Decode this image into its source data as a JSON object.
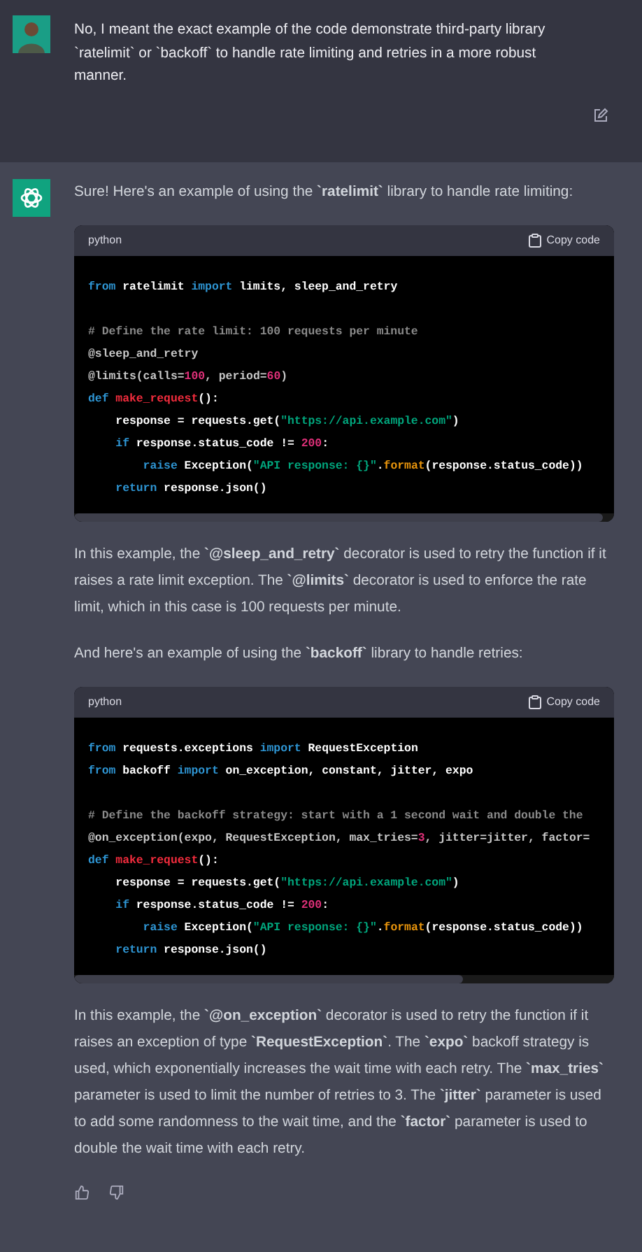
{
  "user_message": {
    "text": "No, I meant the exact example of the code demonstrate third-party library `ratelimit` or `backoff` to handle rate limiting and retries in a more robust manner."
  },
  "assistant_message": {
    "blocks": [
      {
        "kind": "paragraph",
        "text": "Sure! Here's an example of using the **`ratelimit`** library to handle rate limiting:"
      },
      {
        "kind": "code",
        "language": "python",
        "copy_label": "Copy code",
        "lines": [
          {
            "kind": "code",
            "tokens": [
              {
                "text": "from",
                "kind": "kw"
              },
              {
                "text": " ratelimit ",
                "kind": "plain"
              },
              {
                "text": "import",
                "kind": "kw"
              },
              {
                "text": " limits, sleep_and_retry",
                "kind": "plain"
              }
            ]
          },
          {
            "kind": "blank"
          },
          {
            "kind": "code",
            "tokens": [
              {
                "text": "# Define the rate limit: 100 requests per minute",
                "kind": "comment"
              }
            ]
          },
          {
            "kind": "code",
            "tokens": [
              {
                "text": "@sleep_and_retry",
                "kind": "deco"
              }
            ]
          },
          {
            "kind": "code",
            "tokens": [
              {
                "text": "@limits(calls=",
                "kind": "deco"
              },
              {
                "text": "100",
                "kind": "num"
              },
              {
                "text": ", period=",
                "kind": "deco"
              },
              {
                "text": "60",
                "kind": "num"
              },
              {
                "text": ")",
                "kind": "deco"
              }
            ]
          },
          {
            "kind": "code",
            "tokens": [
              {
                "text": "def ",
                "kind": "kw"
              },
              {
                "text": "make_request",
                "kind": "fn"
              },
              {
                "text": "():",
                "kind": "plain"
              }
            ]
          },
          {
            "kind": "code",
            "tokens": [
              {
                "text": "    response = requests.get(",
                "kind": "plain"
              },
              {
                "text": "\"https://api.example.com\"",
                "kind": "str"
              },
              {
                "text": ")",
                "kind": "plain"
              }
            ]
          },
          {
            "kind": "code",
            "tokens": [
              {
                "text": "    if",
                "kind": "kw"
              },
              {
                "text": " response.status_code != ",
                "kind": "plain"
              },
              {
                "text": "200",
                "kind": "num"
              },
              {
                "text": ":",
                "kind": "plain"
              }
            ]
          },
          {
            "kind": "code",
            "tokens": [
              {
                "text": "        raise",
                "kind": "kw"
              },
              {
                "text": " Exception(",
                "kind": "plain"
              },
              {
                "text": "\"API response: {}\"",
                "kind": "str"
              },
              {
                "text": ".",
                "kind": "plain"
              },
              {
                "text": "format",
                "kind": "builtin"
              },
              {
                "text": "(response.status_code))",
                "kind": "plain"
              }
            ]
          },
          {
            "kind": "code",
            "tokens": [
              {
                "text": "    return",
                "kind": "kw"
              },
              {
                "text": " response.json()",
                "kind": "plain"
              }
            ]
          }
        ]
      },
      {
        "kind": "paragraph",
        "text": "In this example, the **`@sleep_and_retry`** decorator is used to retry the function if it raises a rate limit exception. The **`@limits`** decorator is used to enforce the rate limit, which in this case is 100 requests per minute."
      },
      {
        "kind": "paragraph",
        "text": "And here's an example of using the **`backoff`** library to handle retries:"
      },
      {
        "kind": "code",
        "language": "python",
        "copy_label": "Copy code",
        "lines": [
          {
            "kind": "code",
            "tokens": [
              {
                "text": "from",
                "kind": "kw"
              },
              {
                "text": " requests.exceptions ",
                "kind": "plain"
              },
              {
                "text": "import",
                "kind": "kw"
              },
              {
                "text": " RequestException",
                "kind": "plain"
              }
            ]
          },
          {
            "kind": "code",
            "tokens": [
              {
                "text": "from",
                "kind": "kw"
              },
              {
                "text": " backoff ",
                "kind": "plain"
              },
              {
                "text": "import",
                "kind": "kw"
              },
              {
                "text": " on_exception, constant, jitter, expo",
                "kind": "plain"
              }
            ]
          },
          {
            "kind": "blank"
          },
          {
            "kind": "code",
            "tokens": [
              {
                "text": "# Define the backoff strategy: start with a 1 second wait and double the",
                "kind": "comment"
              }
            ]
          },
          {
            "kind": "code",
            "tokens": [
              {
                "text": "@on_exception(expo, RequestException, max_tries=",
                "kind": "deco"
              },
              {
                "text": "3",
                "kind": "num"
              },
              {
                "text": ", jitter=jitter, factor=",
                "kind": "deco"
              }
            ]
          },
          {
            "kind": "code",
            "tokens": [
              {
                "text": "def ",
                "kind": "kw"
              },
              {
                "text": "make_request",
                "kind": "fn"
              },
              {
                "text": "():",
                "kind": "plain"
              }
            ]
          },
          {
            "kind": "code",
            "tokens": [
              {
                "text": "    response = requests.get(",
                "kind": "plain"
              },
              {
                "text": "\"https://api.example.com\"",
                "kind": "str"
              },
              {
                "text": ")",
                "kind": "plain"
              }
            ]
          },
          {
            "kind": "code",
            "tokens": [
              {
                "text": "    if",
                "kind": "kw"
              },
              {
                "text": " response.status_code != ",
                "kind": "plain"
              },
              {
                "text": "200",
                "kind": "num"
              },
              {
                "text": ":",
                "kind": "plain"
              }
            ]
          },
          {
            "kind": "code",
            "tokens": [
              {
                "text": "        raise",
                "kind": "kw"
              },
              {
                "text": " Exception(",
                "kind": "plain"
              },
              {
                "text": "\"API response: {}\"",
                "kind": "str"
              },
              {
                "text": ".",
                "kind": "plain"
              },
              {
                "text": "format",
                "kind": "builtin"
              },
              {
                "text": "(response.status_code))",
                "kind": "plain"
              }
            ]
          },
          {
            "kind": "code",
            "tokens": [
              {
                "text": "    return",
                "kind": "kw"
              },
              {
                "text": " response.json()",
                "kind": "plain"
              }
            ]
          }
        ]
      },
      {
        "kind": "paragraph",
        "text": "In this example, the **`@on_exception`** decorator is used to retry the function if it raises an exception of type **`RequestException`**. The **`expo`** backoff strategy is used, which exponentially increases the wait time with each retry. The **`max_tries`** parameter is used to limit the number of retries to 3. The **`jitter`** parameter is used to add some randomness to the wait time, and the **`factor`** parameter is used to double the wait time with each retry."
      }
    ]
  }
}
